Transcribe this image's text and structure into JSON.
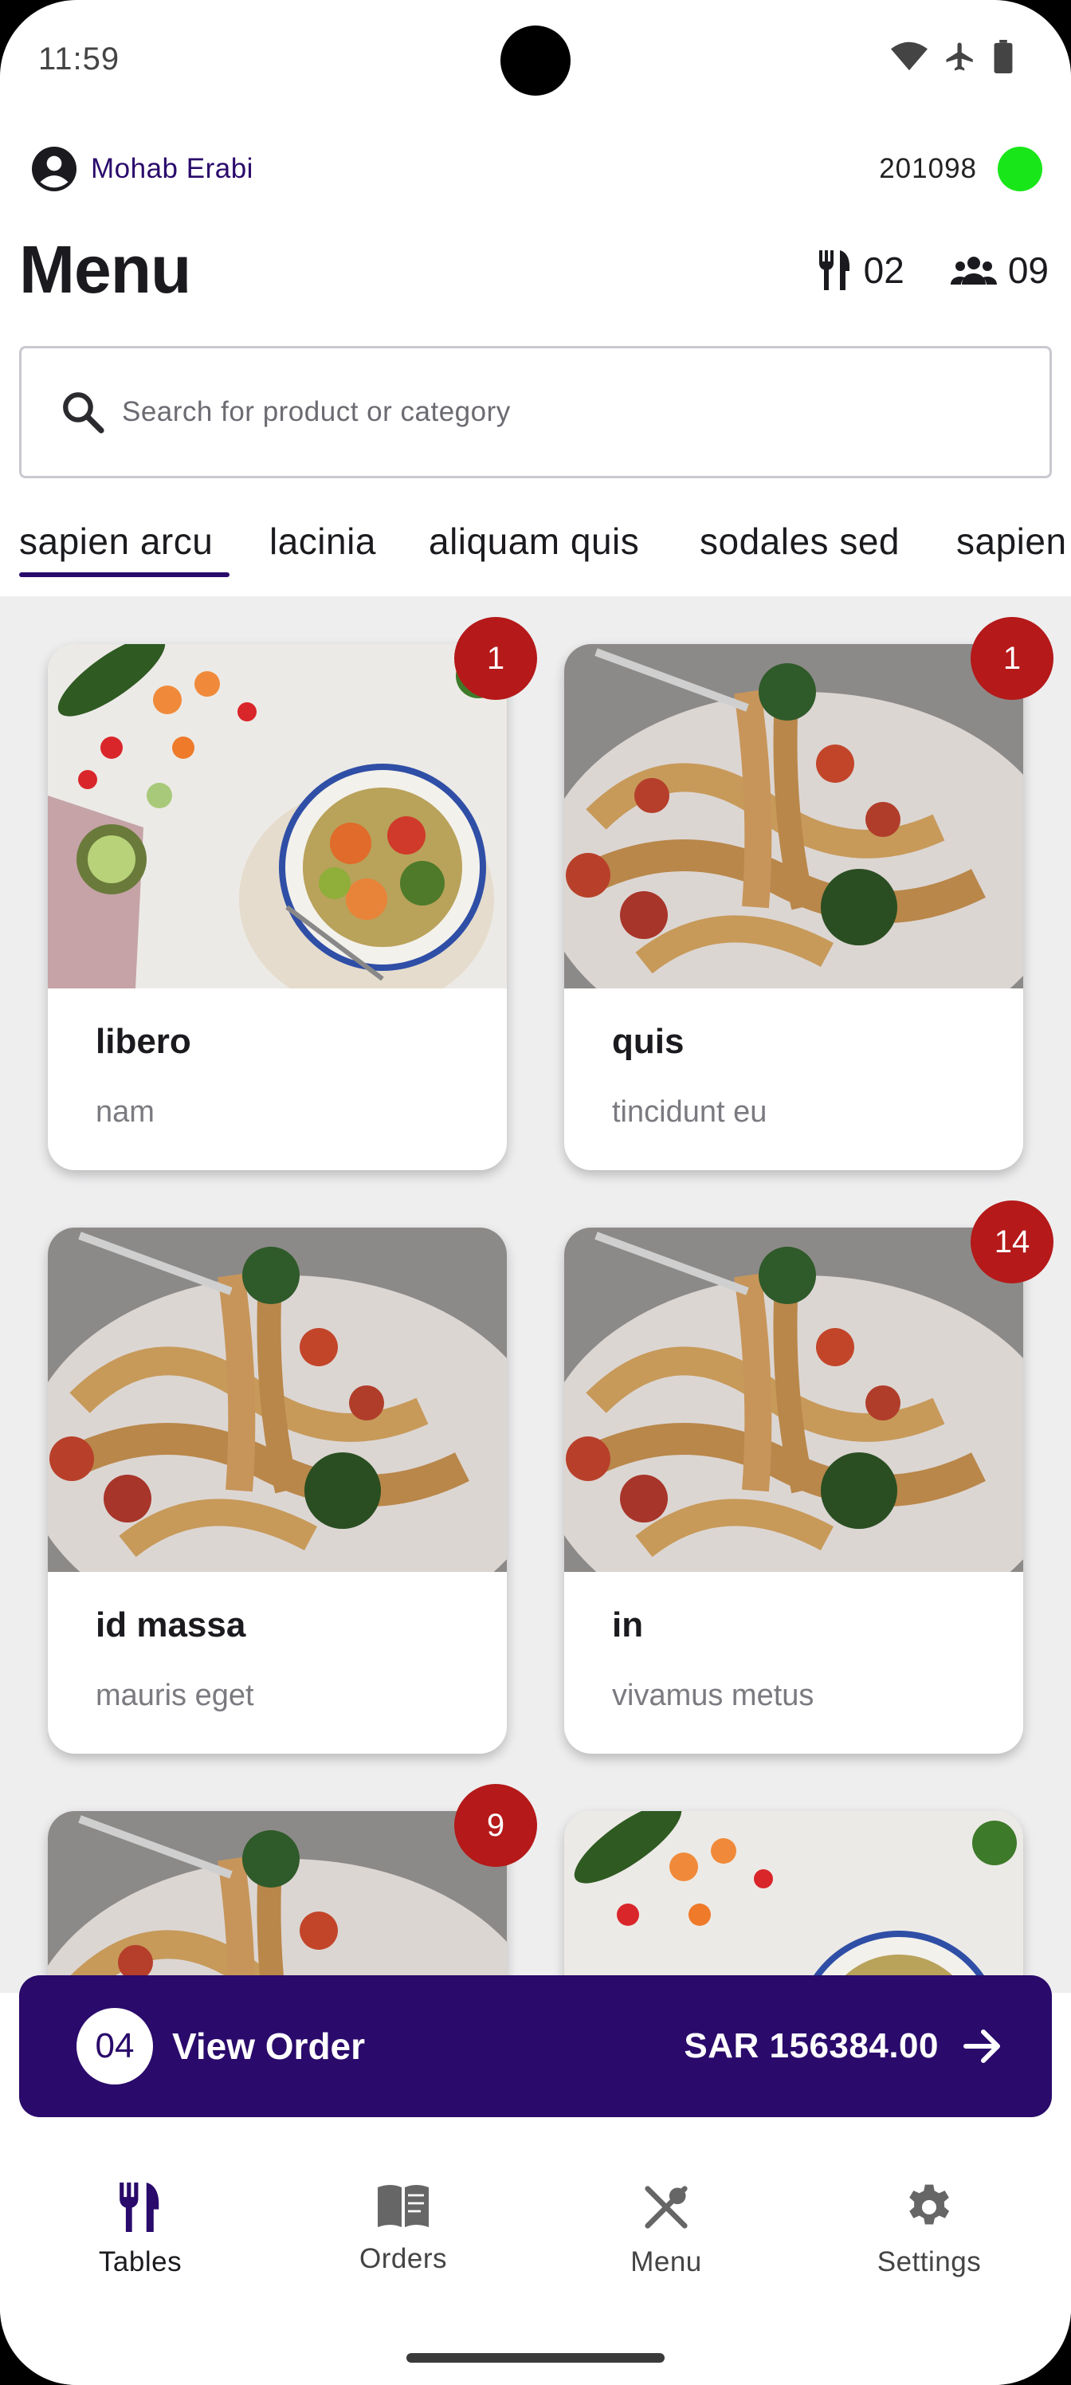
{
  "status_bar": {
    "time": "11:59"
  },
  "header": {
    "user_name": "Mohab Erabi",
    "device_id": "201098",
    "title": "Menu",
    "tables_count": "02",
    "guests_count": "09"
  },
  "search": {
    "placeholder": "Search for product or category"
  },
  "tabs": [
    "sapien arcu",
    "lacinia",
    "aliquam quis",
    "sodales sed",
    "sapien"
  ],
  "products": [
    {
      "title": "libero",
      "subtitle": "nam",
      "badge": "1",
      "image": "vegetable-bowl"
    },
    {
      "title": "quis",
      "subtitle": "tincidunt eu",
      "badge": "1",
      "image": "pasta"
    },
    {
      "title": "id massa",
      "subtitle": "mauris eget",
      "badge": "",
      "image": "pasta"
    },
    {
      "title": "in",
      "subtitle": "vivamus metus",
      "badge": "14",
      "image": "pasta"
    },
    {
      "title": "",
      "subtitle": "",
      "badge": "9",
      "image": "pasta"
    },
    {
      "title": "",
      "subtitle": "",
      "badge": "",
      "image": "vegetable-bowl"
    }
  ],
  "order_bar": {
    "count": "04",
    "label": "View Order",
    "total": "SAR 156384.00"
  },
  "bottom_nav": {
    "tables": "Tables",
    "orders": "Orders",
    "menu": "Menu",
    "settings": "Settings"
  },
  "colors": {
    "primary": "#2a0a6b",
    "badge": "#b51919",
    "online": "#19e619",
    "background": "#eeeeef"
  }
}
